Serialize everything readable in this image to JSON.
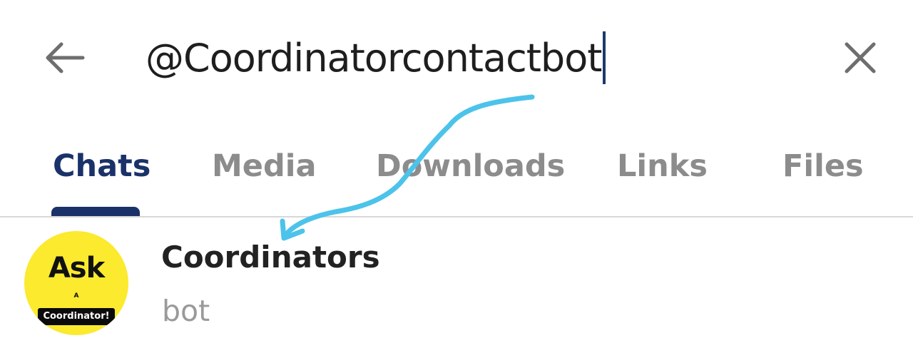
{
  "header": {
    "back_icon": "arrow-left-icon",
    "search_value": "@Coordinatorcontactbot",
    "clear_icon": "close-icon"
  },
  "tabs": [
    {
      "label": "Chats",
      "active": true
    },
    {
      "label": "Media",
      "active": false
    },
    {
      "label": "Downloads",
      "active": false
    },
    {
      "label": "Links",
      "active": false
    },
    {
      "label": "Files",
      "active": false
    }
  ],
  "results": [
    {
      "name": "Coordinators",
      "subtitle": "bot",
      "avatar": {
        "line1": "Ask",
        "line2": "A",
        "line3": "Coordinator!",
        "background": "#fbea2e"
      }
    }
  ],
  "colors": {
    "accent": "#1a3269",
    "inactive_tab": "#8c8c8c",
    "annotation_arrow": "#4cc3ea"
  },
  "annotation": {
    "icon": "hand-drawn-arrow-icon"
  }
}
